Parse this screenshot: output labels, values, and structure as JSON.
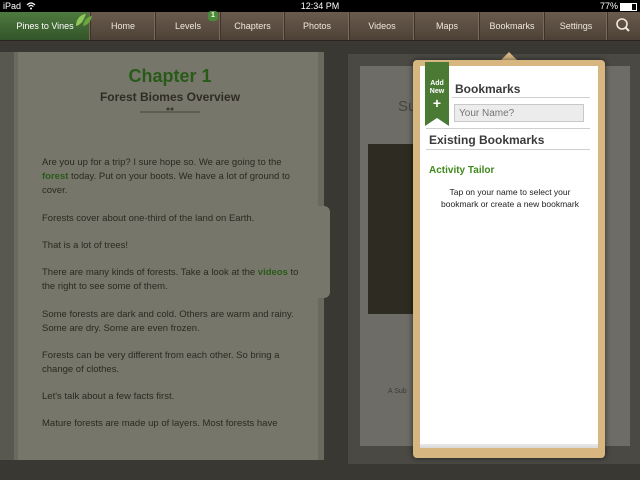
{
  "status": {
    "device": "iPad",
    "time": "12:34 PM",
    "battery": "77%"
  },
  "nav": {
    "brand": "Pines to Vines",
    "tabs": [
      "Home",
      "Levels",
      "Chapters",
      "Photos",
      "Videos",
      "Maps",
      "Bookmarks",
      "Settings"
    ],
    "levels_badge": "1"
  },
  "book": {
    "chapter_title": "Chapter 1",
    "chapter_subtitle": "Forest Biomes Overview",
    "p1a": "Are you up for a trip? I sure hope so. We are going to the ",
    "p1b": "forest",
    "p1c": " today. Put on your boots. We have a lot of ground to cover.",
    "p2": "Forests cover about one-third of the land on Earth.",
    "p3": "That is a lot of trees!",
    "p4a": "There are many kinds of forests. Take a look at the ",
    "p4b": "videos",
    "p4c": " to the right to see some of them.",
    "p5": "Some forests are dark and cold. Others are warm and rainy. Some are dry. Some are even frozen.",
    "p6": "Forests can be very different from each other. So bring a change of clothes.",
    "p7": "Let's talk about a few facts first.",
    "p8": "Mature forests are made up of layers. Most forests have"
  },
  "right_panel": {
    "title_partial": "Su",
    "caption_partial": "A Sub"
  },
  "bookmarks": {
    "ribbon_label_1": "Add",
    "ribbon_label_2": "New",
    "ribbon_plus": "+",
    "heading": "Bookmarks",
    "name_placeholder": "Your Name?",
    "existing_heading": "Existing Bookmarks",
    "user": "Activity Tailor",
    "instructions": "Tap on your name to select your bookmark or create a new bookmark"
  },
  "colors": {
    "accent": "#4b7a35",
    "link": "#3f8a1c",
    "nav_bg": "#5a4c40",
    "tray": "#d8b680"
  }
}
